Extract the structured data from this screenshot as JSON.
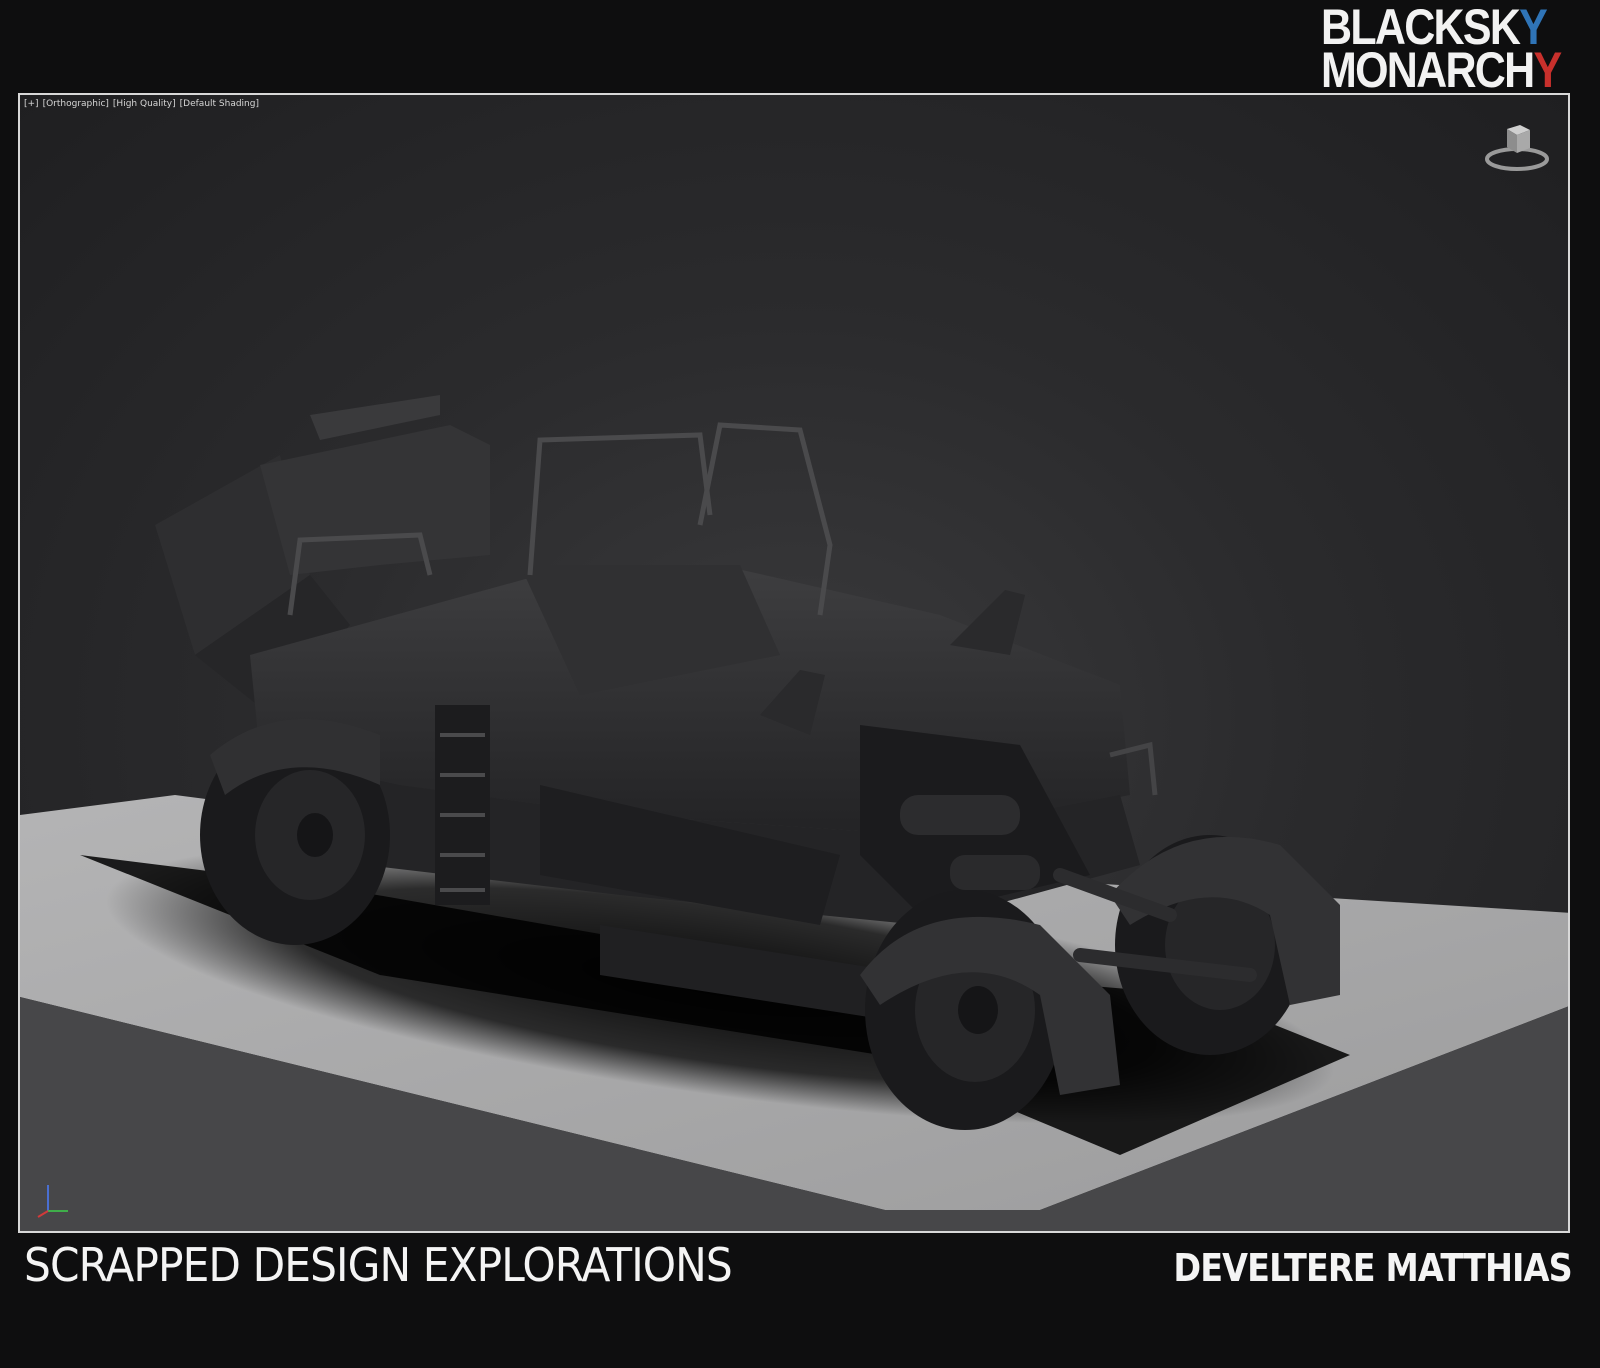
{
  "logo": {
    "line1_main": "BLACKSK",
    "line1_accent": "Y",
    "line2_main": "MONARCH",
    "line2_accent": "Y"
  },
  "viewport": {
    "label_plus": "[+]",
    "label_view": "[Orthographic]",
    "label_quality": "[High Quality]",
    "label_shading": "[Default Shading]"
  },
  "footer": {
    "title": "SCRAPPED DESIGN EXPLORATIONS",
    "author": "DEVELTERE MATTHIAS"
  },
  "colors": {
    "background": "#0e0e0f",
    "viewport_border": "#d8d8d8",
    "logo_blue": "#2f74b7",
    "logo_red": "#c8302c",
    "ground_plane": "#a9a9aa"
  },
  "icons": {
    "viewcube": "viewcube-icon",
    "axis": "axis-gizmo-icon"
  }
}
